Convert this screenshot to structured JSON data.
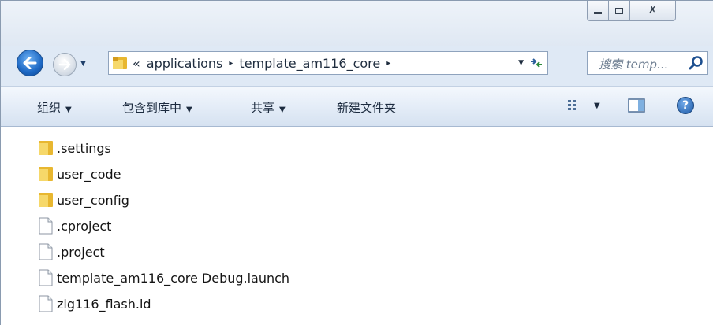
{
  "window": {
    "caption": {
      "minimize": "",
      "maximize": "",
      "close": "✗"
    }
  },
  "nav": {
    "address": {
      "overflow": "«",
      "crumbs": [
        "applications",
        "template_am116_core"
      ],
      "separator": "▸"
    },
    "search": {
      "placeholder": "搜索 temp..."
    }
  },
  "toolbar": {
    "organize": "组织",
    "include_in_library": "包含到库中",
    "share": "共享",
    "new_folder": "新建文件夹",
    "caret": "▼",
    "help": "?"
  },
  "files": [
    {
      "name": ".settings",
      "type": "folder"
    },
    {
      "name": "user_code",
      "type": "folder"
    },
    {
      "name": "user_config",
      "type": "folder"
    },
    {
      "name": ".cproject",
      "type": "file"
    },
    {
      "name": ".project",
      "type": "file"
    },
    {
      "name": "template_am116_core Debug.launch",
      "type": "file"
    },
    {
      "name": "zlg116_flash.ld",
      "type": "file"
    }
  ],
  "colors": {
    "folder": "#e8b730",
    "accent": "#1d68c4",
    "chrome": "#dfe9f5"
  }
}
